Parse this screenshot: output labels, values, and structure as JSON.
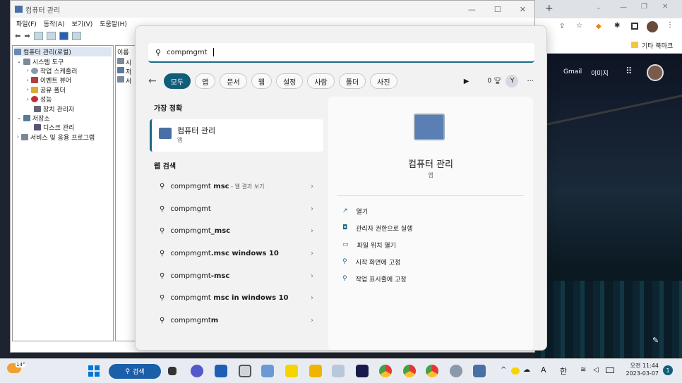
{
  "mmc": {
    "title": "컴퓨터 관리",
    "menu": [
      "파일(F)",
      "동작(A)",
      "보기(V)",
      "도움말(H)"
    ],
    "tree": [
      {
        "label": "컴퓨터 관리(로컬)",
        "indent": 0
      },
      {
        "label": "시스템 도구",
        "indent": 1
      },
      {
        "label": "작업 스케줄러",
        "indent": 2
      },
      {
        "label": "이벤트 뷰어",
        "indent": 2
      },
      {
        "label": "공유 폴더",
        "indent": 2
      },
      {
        "label": "성능",
        "indent": 2
      },
      {
        "label": "장치 관리자",
        "indent": 2
      },
      {
        "label": "저장소",
        "indent": 1
      },
      {
        "label": "디스크 관리",
        "indent": 2
      },
      {
        "label": "서비스 및 응용 프로그램",
        "indent": 1
      }
    ],
    "list_header": "이름",
    "list_items": [
      "시",
      "저",
      "서"
    ]
  },
  "search": {
    "query": "compmgmt",
    "filters": [
      "모두",
      "앱",
      "문서",
      "웹",
      "설정",
      "사람",
      "폴더",
      "사진"
    ],
    "points": "0",
    "avatar_letter": "Y",
    "more": "···",
    "best_match_header": "가장 정확",
    "best_match": {
      "title": "컴퓨터 관리",
      "subtitle": "앱"
    },
    "web_header": "웹 검색",
    "web_results": [
      {
        "plain": "compmgmt",
        "bold": " msc",
        "suffix": " - 웹 결과 보기"
      },
      {
        "plain": "compmgmt",
        "bold": "",
        "suffix": ""
      },
      {
        "plain": "compmgmt",
        "bold": "_msc",
        "suffix": ""
      },
      {
        "plain": "compmgmt",
        "bold": ".msc windows 10",
        "suffix": ""
      },
      {
        "plain": "compmgmt",
        "bold": "-msc",
        "suffix": ""
      },
      {
        "plain": "compmgmt",
        "bold": " msc in windows 10",
        "suffix": ""
      },
      {
        "plain": "compmgmt",
        "bold": "m",
        "suffix": ""
      }
    ],
    "detail": {
      "title": "컴퓨터 관리",
      "subtitle": "앱"
    },
    "actions": [
      "열기",
      "관리자 권한으로 실행",
      "파일 위치 열기",
      "시작 화면에 고정",
      "작업 표시줄에 고정"
    ]
  },
  "browser": {
    "bookmark": "기타 북마크",
    "links": [
      "Gmail",
      "이미지"
    ]
  },
  "taskbar": {
    "weather": "14°",
    "search_label": "검색",
    "ime_a": "A",
    "ime_han": "한",
    "time": "오전 11:44",
    "date": "2023-03-07",
    "notification_count": "1"
  }
}
